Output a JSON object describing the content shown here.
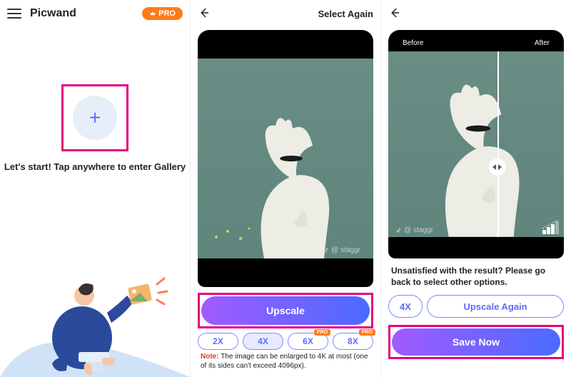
{
  "panel1": {
    "app_name": "Picwand",
    "pro_label": "PRO",
    "start_text": "Let's start! Tap anywhere to enter Gallery"
  },
  "panel2": {
    "select_again": "Select Again",
    "image_credit": "staggr",
    "upscale_label": "Upscale",
    "scales": {
      "x2": "2X",
      "x4": "4X",
      "x6": "6X",
      "x8": "8X"
    },
    "mini_pro": "PRO",
    "note_prefix": "Note:",
    "note_text": " The image can be enlarged to 4K at most (one of its sides can't exceed 4096px)."
  },
  "panel3": {
    "before": "Before",
    "after": "After",
    "image_credit": "staggr",
    "unsatisfied": "Unsatisfied with the result? Please go back to select other options.",
    "chip": "4X",
    "upscale_again": "Upscale Again",
    "save_now": "Save Now"
  }
}
